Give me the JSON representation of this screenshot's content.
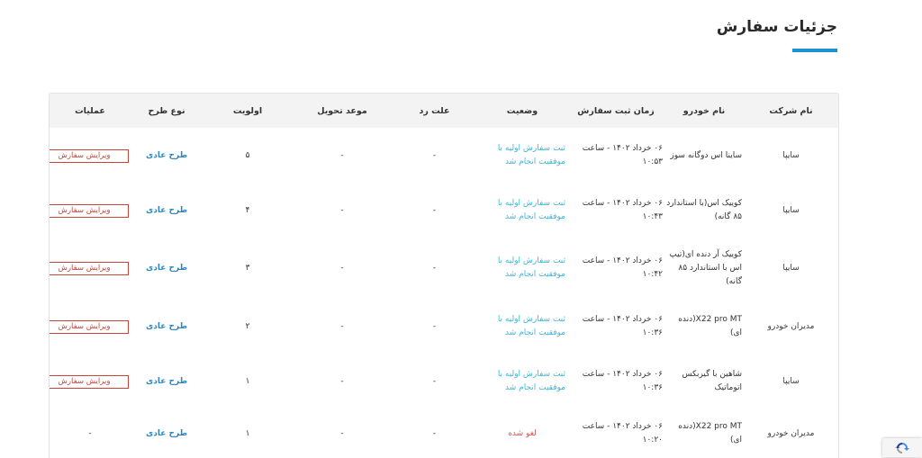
{
  "page": {
    "title": "جزئیات سفارش"
  },
  "table": {
    "headers": {
      "company": "نام شرکت",
      "car": "نام خودرو",
      "time": "زمان ثبت سفارش",
      "status": "وضعیت",
      "reject": "علت رد",
      "delivery": "موعد تحویل",
      "priority": "اولویت",
      "plan": "نوع طرح",
      "ops": "عملیات"
    },
    "rows": [
      {
        "company": "سایپا",
        "car": "ساینا اس دوگانه سوز",
        "time": "۰۶ خرداد ۱۴۰۲ - ساعت ۱۰:۵۳",
        "status": "ثبت سفارش اولیه با موفقیت انجام شد",
        "reject": "-",
        "delivery": "-",
        "priority": "۵",
        "plan": "طرح عادی",
        "ops": "ویرایش سفارش"
      },
      {
        "company": "سایپا",
        "car": "کوییک اس(با استاندارد ۸۵ گانه)",
        "time": "۰۶ خرداد ۱۴۰۲ - ساعت ۱۰:۴۳",
        "status": "ثبت سفارش اولیه با موفقیت انجام شد",
        "reject": "-",
        "delivery": "-",
        "priority": "۴",
        "plan": "طرح عادی",
        "ops": "ویرایش سفارش"
      },
      {
        "company": "سایپا",
        "car": "کوییک آر دنده ای(تیپ اس با استاندارد ۸۵ گانه)",
        "time": "۰۶ خرداد ۱۴۰۲ - ساعت ۱۰:۴۲",
        "status": "ثبت سفارش اولیه با موفقیت انجام شد",
        "reject": "-",
        "delivery": "-",
        "priority": "۳",
        "plan": "طرح عادی",
        "ops": "ویرایش سفارش"
      },
      {
        "company": "مدیران خودرو",
        "car": "X22 pro MT(دنده ای)",
        "time": "۰۶ خرداد ۱۴۰۲ - ساعت ۱۰:۳۶",
        "status": "ثبت سفارش اولیه با موفقیت انجام شد",
        "reject": "-",
        "delivery": "-",
        "priority": "۲",
        "plan": "طرح عادی",
        "ops": "ویرایش سفارش"
      },
      {
        "company": "سایپا",
        "car": "شاهین با گیربکس اتوماتیک",
        "time": "۰۶ خرداد ۱۴۰۲ - ساعت ۱۰:۳۶",
        "status": "ثبت سفارش اولیه با موفقیت انجام شد",
        "reject": "-",
        "delivery": "-",
        "priority": "۱",
        "plan": "طرح عادی",
        "ops": "ویرایش سفارش"
      },
      {
        "company": "مدیران خودرو",
        "car": "X22 pro MT(دنده ای)",
        "time": "۰۶ خرداد ۱۴۰۲ - ساعت ۱۰:۲۰",
        "status": "لغو شده",
        "status_type": "cancel",
        "reject": "-",
        "delivery": "-",
        "priority": "۱",
        "plan": "طرح عادی",
        "ops": "-"
      }
    ]
  },
  "colors": {
    "accent": "#1e90d6",
    "status_success": "#41b6d6",
    "status_cancel": "#d9534f",
    "plan_link": "#2e87c0",
    "edit_button": "#c9433a",
    "header_bg": "#f3f3f3"
  },
  "icons": {
    "recaptcha": "recaptcha-icon"
  }
}
